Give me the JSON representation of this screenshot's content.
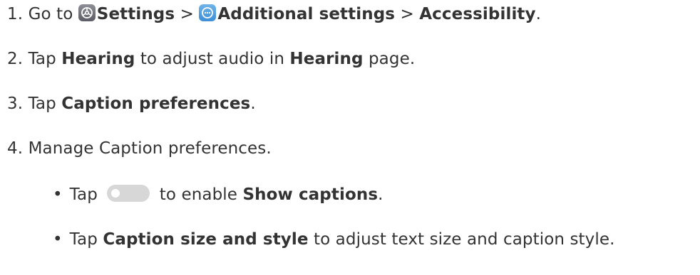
{
  "steps": [
    {
      "num": "1.",
      "t1": "Go to",
      "settings": "Settings",
      "sep1": ">",
      "additional": "Additional settings",
      "sep2": ">",
      "accessibility": "Accessibility",
      "end": "."
    },
    {
      "num": "2.",
      "t1": "Tap",
      "hearing1": "Hearing",
      "t2": "to adjust audio in",
      "hearing2": "Hearing",
      "t3": "page."
    },
    {
      "num": "3.",
      "t1": "Tap",
      "caption_prefs": "Caption preferences",
      "end": "."
    },
    {
      "num": "4.",
      "text": "Manage Caption preferences."
    }
  ],
  "subs": [
    {
      "bullet": "•",
      "t1": "Tap",
      "t2": "to enable",
      "show_captions": "Show captions",
      "end": "."
    },
    {
      "bullet": "•",
      "t1": "Tap",
      "caption_size": "Caption size and style",
      "t2": "to adjust text size and caption style."
    }
  ],
  "icons": {
    "settings": "settings-gear-icon",
    "additional": "more-dots-icon",
    "toggle": "toggle-switch-icon"
  }
}
